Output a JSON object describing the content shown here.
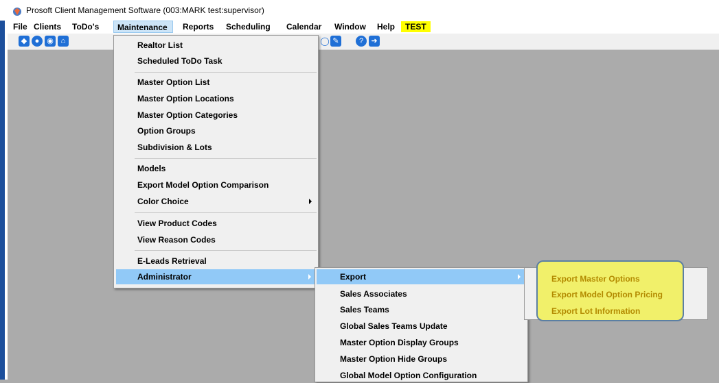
{
  "window": {
    "title": "Prosoft Client Management Software (003:MARK test:supervisor)"
  },
  "menubar": {
    "items": [
      "File",
      "Clients",
      "ToDo's",
      "Maintenance",
      "Reports",
      "Scheduling",
      "Calendar",
      "Window",
      "Help",
      "TEST"
    ],
    "open_item": "Maintenance",
    "test_highlight_color": "#ffff00"
  },
  "toolbar": {
    "icons": [
      "paint-bucket-icon",
      "user-icon",
      "eye-icon",
      "home-icon",
      "edit-icon",
      "help-icon",
      "exit-icon"
    ]
  },
  "maintenance_menu": {
    "items": [
      {
        "label": "Realtor List"
      },
      {
        "label": "Scheduled ToDo Task"
      },
      {
        "label": "Master Option List"
      },
      {
        "label": "Master Option Locations"
      },
      {
        "label": "Master Option Categories"
      },
      {
        "label": "Option Groups"
      },
      {
        "label": "Subdivision & Lots"
      },
      {
        "label": "Models"
      },
      {
        "label": "Export Model Option Comparison"
      },
      {
        "label": "Color Choice",
        "has_submenu": true
      },
      {
        "label": "View Product Codes"
      },
      {
        "label": "View Reason Codes"
      },
      {
        "label": "E-Leads Retrieval"
      },
      {
        "label": "Administrator",
        "has_submenu": true,
        "highlighted": true
      }
    ]
  },
  "administrator_menu": {
    "items": [
      {
        "label": "Export",
        "has_submenu": true,
        "highlighted": true
      },
      {
        "label": "Sales Associates"
      },
      {
        "label": "Sales Teams"
      },
      {
        "label": "Global Sales Teams Update"
      },
      {
        "label": "Master Option Display Groups"
      },
      {
        "label": "Master Option Hide Groups"
      },
      {
        "label": "Global Model Option Configuration"
      }
    ]
  },
  "export_menu": {
    "items": [
      {
        "label": "Export Master Options"
      },
      {
        "label": "Export Model Option Pricing"
      },
      {
        "label": "Export Lot Information"
      }
    ],
    "callout_color": "#f1f06a"
  }
}
